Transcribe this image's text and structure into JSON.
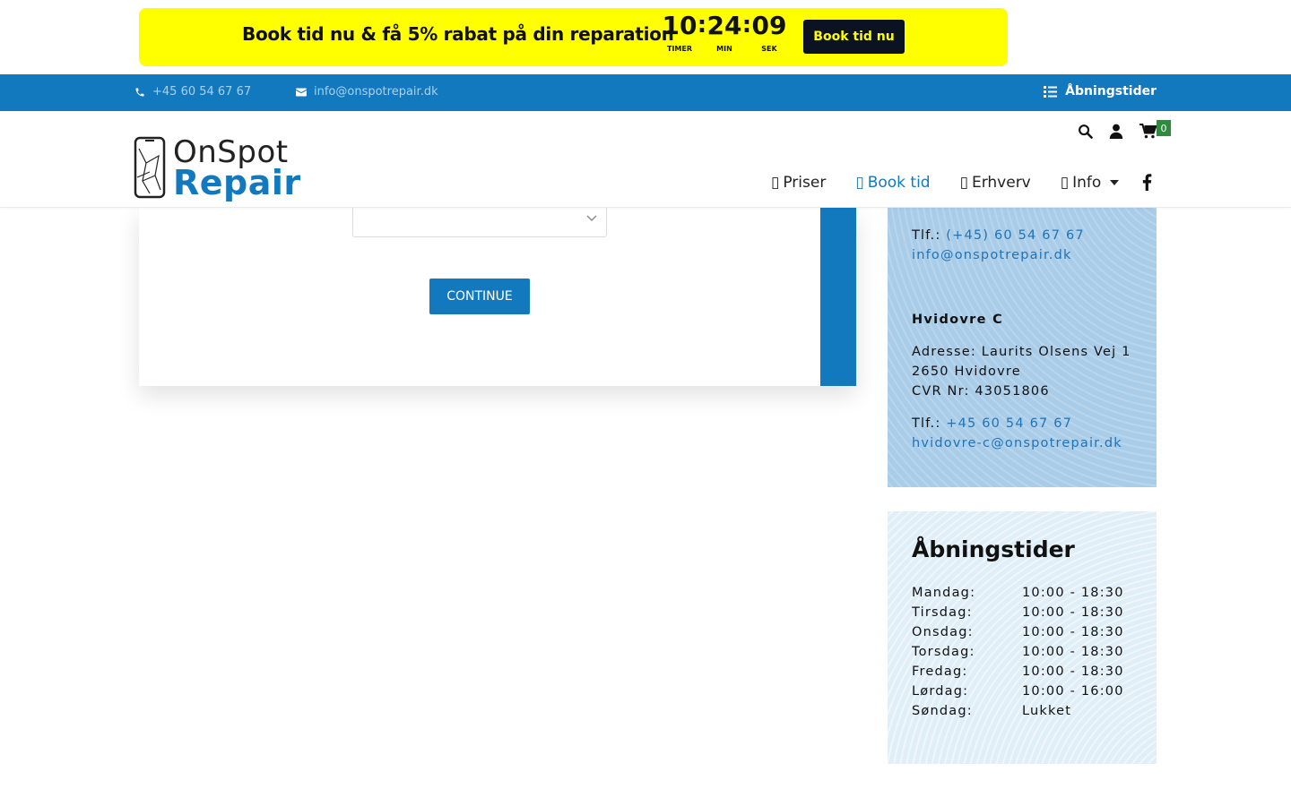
{
  "promo": {
    "text": "Book tid nu & få 5% rabat på din reparation",
    "countdown": {
      "hours": "10",
      "hours_label": "TIMER",
      "minutes": "24",
      "minutes_label": "MIN",
      "seconds": "09",
      "seconds_label": "SEK",
      "separator": ":"
    },
    "button": "Book tid nu"
  },
  "topbar": {
    "phone": "+45 60 54 67 67",
    "email": "info@onspotrepair.dk",
    "hours_link": "Åbningstider"
  },
  "header": {
    "logo_line1": "OnSpot",
    "logo_line2": "Repair",
    "cart_count": "0",
    "nav": [
      {
        "label": "Priser"
      },
      {
        "label": "Book tid"
      },
      {
        "label": "Erhverv"
      },
      {
        "label": "Info"
      }
    ]
  },
  "form": {
    "select_value": "",
    "continue": "CONTINUE"
  },
  "contact": {
    "tlf_label": "Tlf.:",
    "main_phone": "(+45) 60 54 67 67",
    "main_email": "info@onspotrepair.dk",
    "location_name": "Hvidovre C",
    "address": "Adresse: Laurits Olsens Vej 1",
    "city": "2650 Hvidovre",
    "cvr": "CVR Nr: 43051806",
    "location_phone": "+45 60 54 67 67",
    "location_email": "hvidovre-c@onspotrepair.dk"
  },
  "opening_hours": {
    "title": "Åbningstider",
    "rows": [
      {
        "day": "Mandag:",
        "time": "10:00 - 18:30"
      },
      {
        "day": "Tirsdag:",
        "time": "10:00 - 18:30"
      },
      {
        "day": "Onsdag:",
        "time": "10:00 - 18:30"
      },
      {
        "day": "Torsdag:",
        "time": "10:00 - 18:30"
      },
      {
        "day": "Fredag:",
        "time": "10:00 - 18:30"
      },
      {
        "day": "Lørdag:",
        "time": "10:00 - 16:00"
      },
      {
        "day": "Søndag:",
        "time": "Lukket"
      }
    ]
  },
  "colors": {
    "brand_blue": "#1379bf",
    "promo_yellow": "#ffff00",
    "dark": "#0b1222",
    "cart_badge": "#2e8b3e"
  }
}
